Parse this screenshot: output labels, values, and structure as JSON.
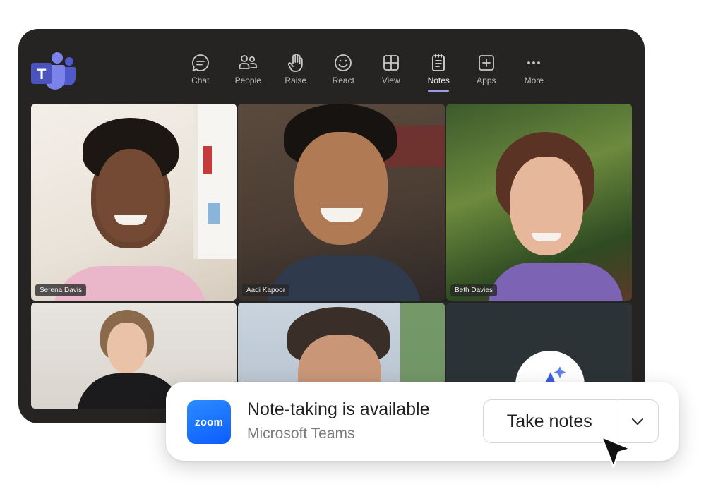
{
  "toolbar": {
    "items": [
      {
        "label": "Chat",
        "icon": "chat-icon"
      },
      {
        "label": "People",
        "icon": "people-icon"
      },
      {
        "label": "Raise",
        "icon": "raise-hand-icon"
      },
      {
        "label": "React",
        "icon": "smiley-icon"
      },
      {
        "label": "View",
        "icon": "grid-view-icon"
      },
      {
        "label": "Notes",
        "icon": "notes-icon",
        "active": true
      },
      {
        "label": "Apps",
        "icon": "plus-square-icon"
      },
      {
        "label": "More",
        "icon": "more-dots-icon"
      }
    ],
    "active_color": "#9b99e8"
  },
  "participants": [
    {
      "name": "Serena Davis"
    },
    {
      "name": "Aadi Kapoor"
    },
    {
      "name": "Beth Davies"
    }
  ],
  "notification": {
    "app_logo_text": "zoom",
    "title": "Note-taking is available",
    "subtitle": "Microsoft Teams",
    "primary_button": "Take notes",
    "zoom_color": "#0b5cff"
  },
  "colors": {
    "teams_bg": "#252423",
    "teams_brand": "#5b5fc7"
  }
}
